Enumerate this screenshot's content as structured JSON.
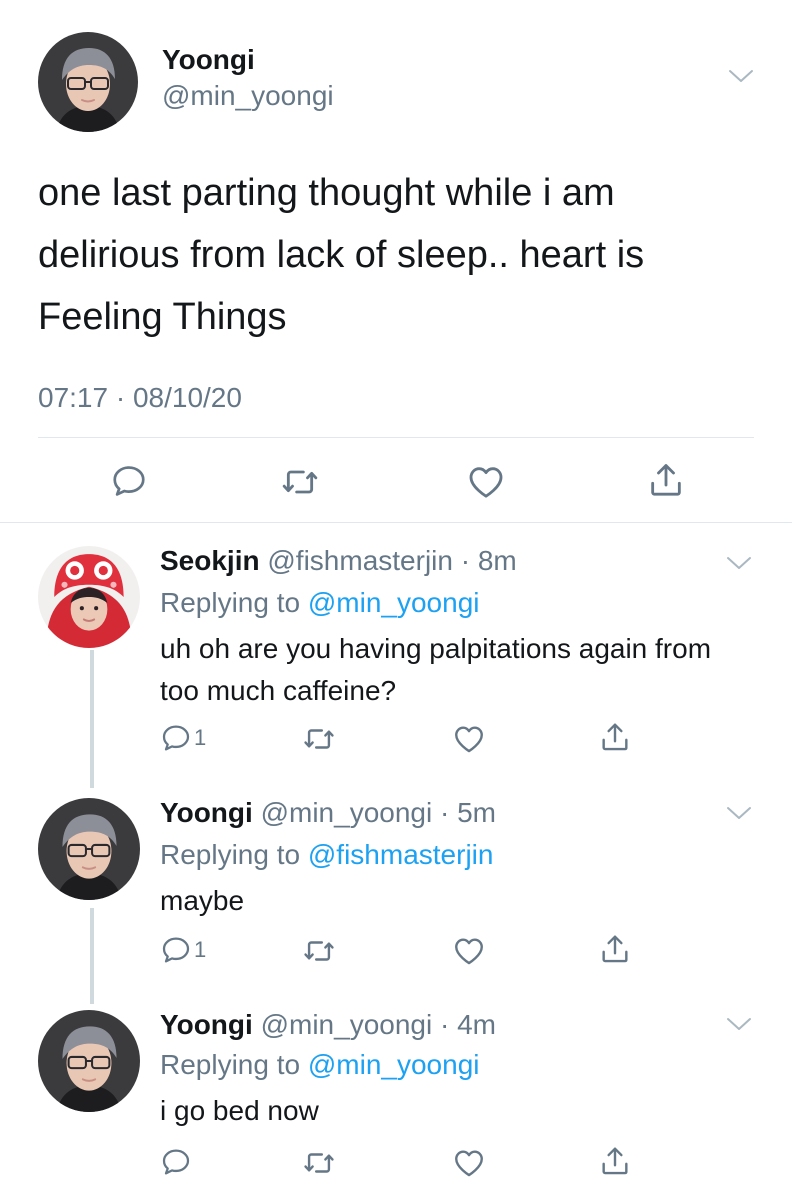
{
  "main_tweet": {
    "display_name": "Yoongi",
    "handle": "@min_yoongi",
    "text": "one last parting thought while i am delirious from lack of sleep.. heart is Feeling Things",
    "timestamp": "07:17 · 08/10/20",
    "actions": [
      "reply-icon",
      "retweet-icon",
      "like-icon",
      "share-icon"
    ]
  },
  "replies": [
    {
      "display_name": "Seokjin",
      "handle": "@fishmasterjin",
      "time": "8m",
      "replying_prefix": "Replying to",
      "replying_to": "@min_yoongi",
      "text": "uh oh are you having palpitations again from too much caffeine?",
      "reply_count": "1"
    },
    {
      "display_name": "Yoongi",
      "handle": "@min_yoongi",
      "time": "5m",
      "replying_prefix": "Replying to",
      "replying_to": "@fishmasterjin",
      "text": "maybe",
      "reply_count": "1"
    },
    {
      "display_name": "Yoongi",
      "handle": "@min_yoongi",
      "time": "4m",
      "replying_prefix": "Replying to",
      "replying_to": "@min_yoongi",
      "text": "i go bed now",
      "reply_count": ""
    }
  ],
  "colors": {
    "text": "#14171a",
    "secondary": "#657786",
    "link": "#1da1f2",
    "divider": "#e1e8ed"
  }
}
